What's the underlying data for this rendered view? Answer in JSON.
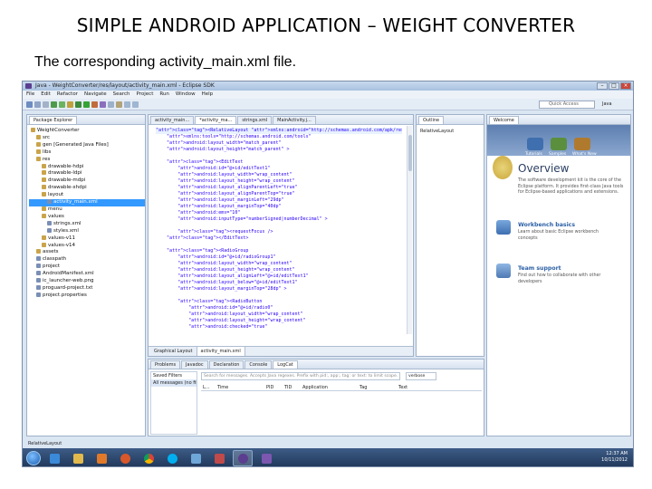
{
  "slide": {
    "title": "SIMPLE ANDROID APPLICATION – WEIGHT CONVERTER",
    "subtitle": "The corresponding activity_main.xml file."
  },
  "window": {
    "title": "Java - WeightConverter/res/layout/activity_main.xml - Eclipse SDK",
    "menu": [
      "File",
      "Edit",
      "Refactor",
      "Navigate",
      "Search",
      "Project",
      "Run",
      "Window",
      "Help"
    ],
    "quick_access": "Quick Access",
    "perspective": "Java"
  },
  "package_explorer": {
    "tab_label": "Package Explorer",
    "tree": [
      "WeightConverter",
      "src",
      "gen [Generated Java Files]",
      "libs",
      "res",
      "drawable-hdpi",
      "drawable-ldpi",
      "drawable-mdpi",
      "drawable-xhdpi",
      "layout",
      "activity_main.xml",
      "menu",
      "values",
      "strings.xml",
      "styles.xml",
      "values-v11",
      "values-v14",
      "assets",
      "classpath",
      "project",
      "AndroidManifest.xml",
      "ic_launcher-web.png",
      "proguard-project.txt",
      "project.properties"
    ],
    "selected_index": 10
  },
  "editor": {
    "tabs": [
      "activity_main...",
      "*activity_ma...",
      "strings.xml",
      "MainActivity.j..."
    ],
    "bottom_tabs": [
      "Graphical Layout",
      "activity_main.xml"
    ],
    "code": [
      "<RelativeLayout xmlns:android=\"http://schemas.android.com/apk/res/android\"",
      "    xmlns:tools=\"http://schemas.android.com/tools\"",
      "    android:layout_width=\"match_parent\"",
      "    android:layout_height=\"match_parent\" >",
      "",
      "    <EditText",
      "        android:id=\"@+id/editText1\"",
      "        android:layout_width=\"wrap_content\"",
      "        android:layout_height=\"wrap_content\"",
      "        android:layout_alignParentLeft=\"true\"",
      "        android:layout_alignParentTop=\"true\"",
      "        android:layout_marginLeft=\"29dp\"",
      "        android:layout_marginTop=\"40dp\"",
      "        android:ems=\"10\"",
      "        android:inputType=\"numberSigned|numberDecimal\" >",
      "",
      "        <requestFocus />",
      "    </EditText>",
      "",
      "    <RadioGroup",
      "        android:id=\"@+id/radioGroup1\"",
      "        android:layout_width=\"wrap_content\"",
      "        android:layout_height=\"wrap_content\"",
      "        android:layout_alignLeft=\"@+id/editText1\"",
      "        android:layout_below=\"@+id/editText1\"",
      "        android:layout_marginTop=\"28dp\" >",
      "",
      "        <RadioButton",
      "            android:id=\"@+id/radio0\"",
      "            android:layout_width=\"wrap_content\"",
      "            android:layout_height=\"wrap_content\"",
      "            android:checked=\"true\""
    ]
  },
  "outline": {
    "tab_label": "Outline",
    "root": "RelativeLayout"
  },
  "welcome": {
    "tab_label": "Welcome",
    "nav": [
      "Tutorials",
      "Samples",
      "What's New"
    ],
    "overview_title": "Overview",
    "overview_text": "The software development kit is the core of the Eclipse platform. It provides first-class Java tools for Eclipse-based applications and extensions.",
    "sections": [
      {
        "title": "Workbench basics",
        "text": "Learn about basic Eclipse workbench concepts"
      },
      {
        "title": "Team support",
        "text": "Find out how to collaborate with other developers"
      }
    ]
  },
  "console": {
    "tabs": [
      "Problems",
      "Javadoc",
      "Declaration",
      "Console",
      "LogCat"
    ],
    "saved_filters": "Saved Filters",
    "all_messages": "All messages (no filters)",
    "search_placeholder": "Search for messages. Accepts Java regexes. Prefix with pid:, app:, tag: or text: to limit scope.",
    "level": "verbose",
    "columns": [
      "L...",
      "Time",
      "PID",
      "TID",
      "Application",
      "Tag",
      "Text"
    ]
  },
  "status": {
    "text": "RelativeLayout"
  },
  "taskbar": {
    "time": "12:37 AM",
    "date": "10/11/2012"
  }
}
